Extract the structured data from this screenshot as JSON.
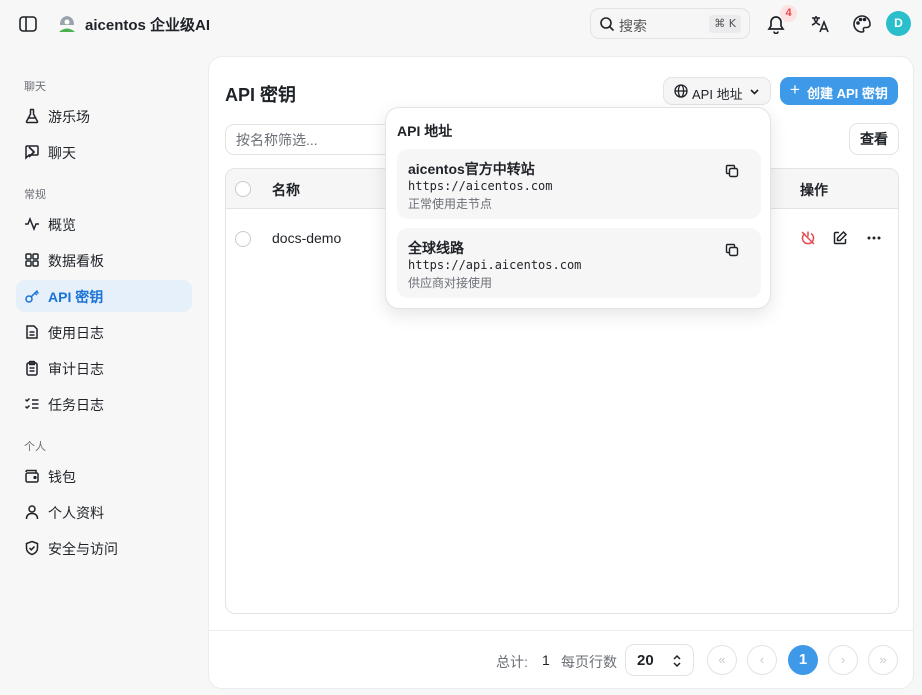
{
  "app": {
    "title": "aicentos 企业级AI",
    "avatar_initial": "D",
    "notification_count": "4"
  },
  "search": {
    "placeholder": "搜索",
    "shortcut": "⌘ K"
  },
  "sidebar": {
    "sections": [
      {
        "title": "聊天"
      },
      {
        "title": "常规"
      },
      {
        "title": "个人"
      }
    ],
    "items": [
      {
        "label": "游乐场",
        "icon": "flask-icon"
      },
      {
        "label": "聊天",
        "icon": "message-square-icon"
      },
      {
        "label": "概览",
        "icon": "activity-icon"
      },
      {
        "label": "数据看板",
        "icon": "layout-grid-icon"
      },
      {
        "label": "API 密钥",
        "icon": "key-icon",
        "active": true
      },
      {
        "label": "使用日志",
        "icon": "file-text-icon"
      },
      {
        "label": "审计日志",
        "icon": "clipboard-list-icon"
      },
      {
        "label": "任务日志",
        "icon": "list-checks-icon"
      },
      {
        "label": "钱包",
        "icon": "wallet-icon"
      },
      {
        "label": "个人资料",
        "icon": "user-icon"
      },
      {
        "label": "安全与访问",
        "icon": "shield-check-icon"
      }
    ]
  },
  "main": {
    "title": "API 密钥",
    "api_address_button": "API 地址",
    "create_button": "创建 API 密钥",
    "filter_placeholder": "按名称筛选...",
    "view_button": "查看",
    "table": {
      "columns": {
        "name": "名称",
        "actions": "操作"
      },
      "rows": [
        {
          "name": "docs-demo"
        }
      ]
    },
    "footer": {
      "total_label": "总计:",
      "total": "1",
      "per_page_label": "每页行数",
      "page_size": "20",
      "current_page": "1"
    }
  },
  "popover": {
    "title": "API 地址",
    "endpoints": [
      {
        "name": "aicentos官方中转站",
        "url": "https://aicentos.com",
        "desc": "正常使用走节点"
      },
      {
        "name": "全球线路",
        "url": "https://api.aicentos.com",
        "desc": "供应商对接使用"
      }
    ]
  },
  "colors": {
    "accent": "#3e9ae8",
    "active_bg": "#e6f0fb",
    "danger": "#e5484d",
    "avatar": "#2bbfcb"
  }
}
